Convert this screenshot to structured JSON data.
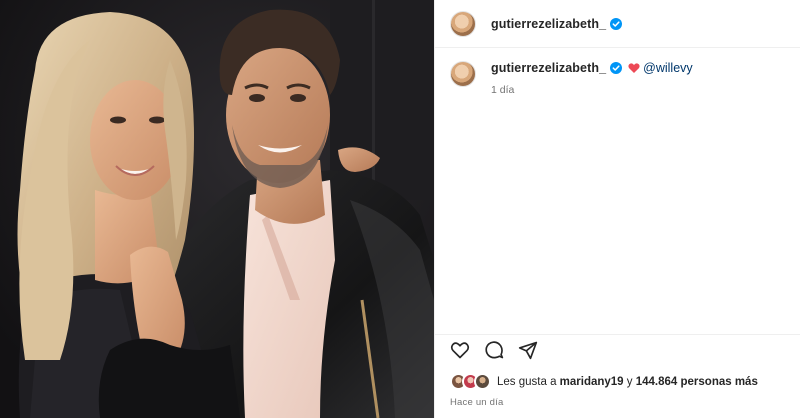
{
  "post": {
    "username": "gutierrezelizabeth_",
    "verified": true
  },
  "caption": {
    "username": "gutierrezelizabeth_",
    "emoji": "heart-emoji",
    "mention": "@willevy",
    "time": "1 día"
  },
  "actions": [
    "like",
    "comment",
    "share"
  ],
  "likes": {
    "prefix": "Les gusta a ",
    "user": "maridany19",
    "middle": " y ",
    "count": "144.864 personas más"
  },
  "posted": "Hace un día",
  "colors": {
    "verified": "#0095f6",
    "heart": "#ed4956",
    "mention": "#00376b",
    "muted": "#737373",
    "divider": "#efefef"
  },
  "icons": {
    "verified": "verified-badge-icon",
    "like": "heart-outline-icon",
    "comment": "comment-bubble-icon",
    "share": "paper-plane-icon"
  }
}
